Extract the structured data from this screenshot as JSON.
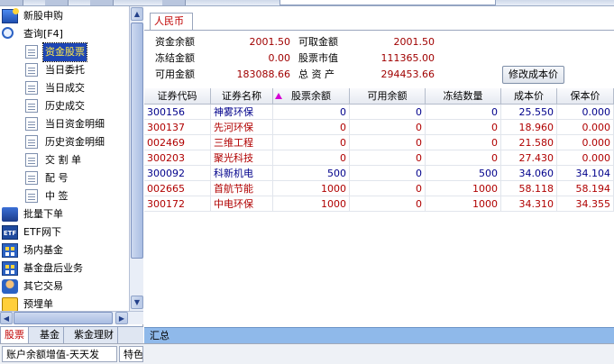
{
  "tree": [
    {
      "label": "新股申购",
      "icon": "new-stock-icon",
      "level": 0
    },
    {
      "label": "查询[F4]",
      "icon": "query-magnifier-icon",
      "level": 0
    },
    {
      "label": "资金股票",
      "icon": "document-icon",
      "level": 1,
      "selected": true
    },
    {
      "label": "当日委托",
      "icon": "document-icon",
      "level": 1
    },
    {
      "label": "当日成交",
      "icon": "document-icon",
      "level": 1
    },
    {
      "label": "历史成交",
      "icon": "document-icon",
      "level": 1
    },
    {
      "label": "当日资金明细",
      "icon": "document-icon",
      "level": 1
    },
    {
      "label": "历史资金明细",
      "icon": "document-icon",
      "level": 1
    },
    {
      "label": "交 割 单",
      "icon": "document-icon",
      "level": 1
    },
    {
      "label": "配    号",
      "icon": "document-icon",
      "level": 1
    },
    {
      "label": "中    签",
      "icon": "document-icon",
      "level": 1
    },
    {
      "label": "批量下单",
      "icon": "batch-order-icon",
      "level": 0
    },
    {
      "label": "ETF网下",
      "icon": "etf-icon",
      "level": 0
    },
    {
      "label": "场内基金",
      "icon": "fund-grid-icon",
      "level": 0
    },
    {
      "label": "基金盘后业务",
      "icon": "fund-grid-icon",
      "level": 0
    },
    {
      "label": "其它交易",
      "icon": "person-icon",
      "level": 0
    },
    {
      "label": "预埋单",
      "icon": "preorder-icon",
      "level": 0
    }
  ],
  "left_tabs": [
    "股票",
    "基金",
    "紫金理财"
  ],
  "status_bar": [
    "账户余额增值-天天发",
    "特色"
  ],
  "currency_tab": "人民币",
  "summary_fields": [
    {
      "label": "资金余额",
      "value": "2001.50"
    },
    {
      "label": "可取金额",
      "value": "2001.50"
    },
    {
      "label": "冻结金额",
      "value": "0.00"
    },
    {
      "label": "股票市值",
      "value": "111365.00"
    },
    {
      "label": "可用金额",
      "value": "183088.66"
    },
    {
      "label": "总 资 产",
      "value": "294453.66"
    }
  ],
  "modify_cost_button": "修改成本价",
  "table": {
    "columns": [
      "证券代码",
      "证券名称",
      "股票余额",
      "可用余额",
      "冻结数量",
      "成本价",
      "保本价"
    ],
    "rows": [
      {
        "code": "300156",
        "name": "神雾环保",
        "balance": "0",
        "available": "0",
        "frozen": "0",
        "cost": "25.550",
        "breakeven": "0.000",
        "color": "#00008b"
      },
      {
        "code": "300137",
        "name": "先河环保",
        "balance": "0",
        "available": "0",
        "frozen": "0",
        "cost": "18.960",
        "breakeven": "0.000",
        "color": "#b00000"
      },
      {
        "code": "002469",
        "name": "三维工程",
        "balance": "0",
        "available": "0",
        "frozen": "0",
        "cost": "21.580",
        "breakeven": "0.000",
        "color": "#b00000"
      },
      {
        "code": "300203",
        "name": "聚光科技",
        "balance": "0",
        "available": "0",
        "frozen": "0",
        "cost": "27.430",
        "breakeven": "0.000",
        "color": "#b00000"
      },
      {
        "code": "300092",
        "name": "科新机电",
        "balance": "500",
        "available": "0",
        "frozen": "500",
        "cost": "34.060",
        "breakeven": "34.104",
        "color": "#00008b"
      },
      {
        "code": "002665",
        "name": "首航节能",
        "balance": "1000",
        "available": "0",
        "frozen": "1000",
        "cost": "58.118",
        "breakeven": "58.194",
        "color": "#b00000"
      },
      {
        "code": "300172",
        "name": "中电环保",
        "balance": "1000",
        "available": "0",
        "frozen": "1000",
        "cost": "34.310",
        "breakeven": "34.355",
        "color": "#b00000"
      }
    ]
  },
  "summary_row_label": "汇总",
  "colors": {
    "selection_bg": "#1e46b4",
    "selection_text": "#ffe94a",
    "value_red": "#a00000",
    "summary_bar": "#8fb9ea"
  }
}
